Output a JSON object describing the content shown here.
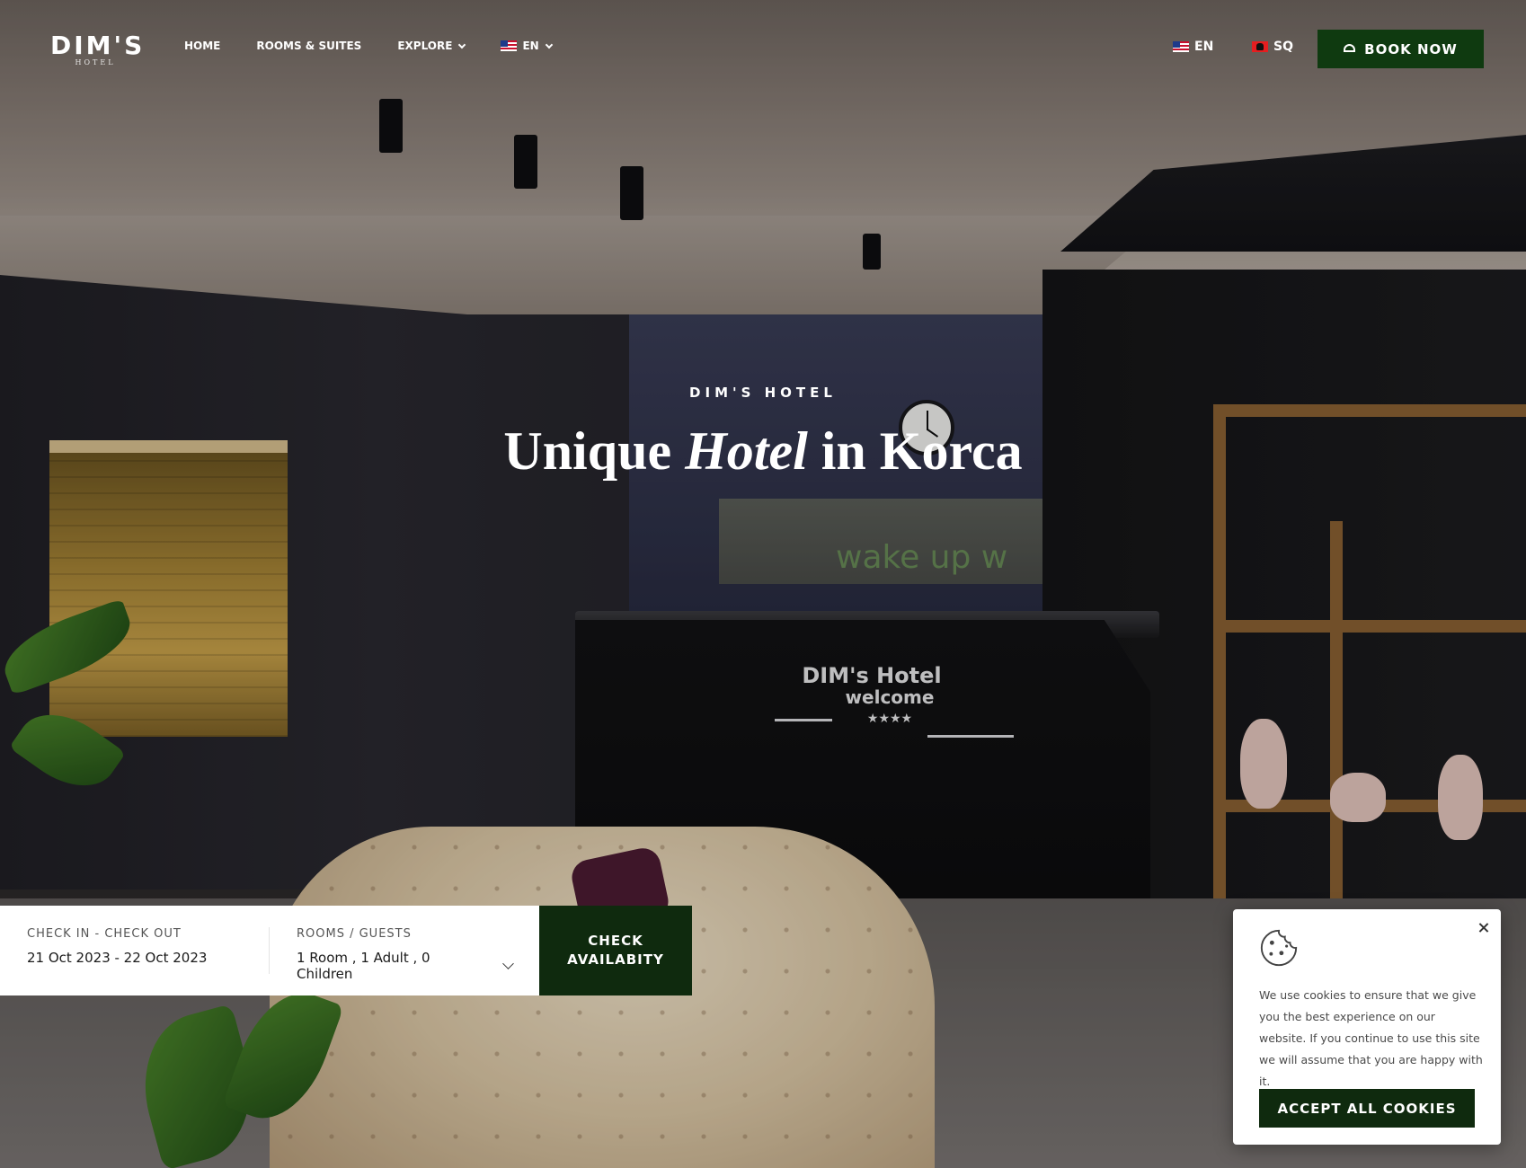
{
  "brand": {
    "logo_main": "DIM'S",
    "logo_sub": "HOTEL"
  },
  "nav": {
    "items": [
      {
        "label": "HOME"
      },
      {
        "label": "ROOMS & SUITES"
      },
      {
        "label": "EXPLORE"
      },
      {
        "label": "EN"
      }
    ]
  },
  "languages": [
    {
      "label": "EN",
      "flag": "flag-us-icon"
    },
    {
      "label": "SQ",
      "flag": "flag-al-icon"
    }
  ],
  "book_button": {
    "label": "BOOK NOW",
    "icon": "bell-icon"
  },
  "hero": {
    "eyebrow": "DIM'S HOTEL",
    "headline_prefix": "Unique",
    "headline_emphasis": "Hotel",
    "headline_suffix": "in Korca",
    "desk_sign_line1": "DIM's Hotel",
    "desk_sign_line2": "welcome",
    "desk_sign_stars": "★★★★",
    "mirror_text": "wake up w"
  },
  "booking": {
    "dates_label": "CHECK IN - CHECK OUT",
    "dates_value": "21 Oct 2023 - 22 Oct 2023",
    "guests_label": "ROOMS / GUESTS",
    "guests_value": "1 Room , 1 Adult , 0 Children",
    "check_line1": "CHECK",
    "check_line2": "AVAILABITY"
  },
  "cookie_notice": {
    "text": "We use cookies to ensure that we give you the best experience on our website. If you continue to use this site we will assume that you are happy with it.",
    "accept_label": "ACCEPT ALL COOKIES"
  },
  "colors": {
    "accent_green": "#0f3a10",
    "button_dark_green": "#0f2a0e",
    "text_white": "#ffffff"
  }
}
